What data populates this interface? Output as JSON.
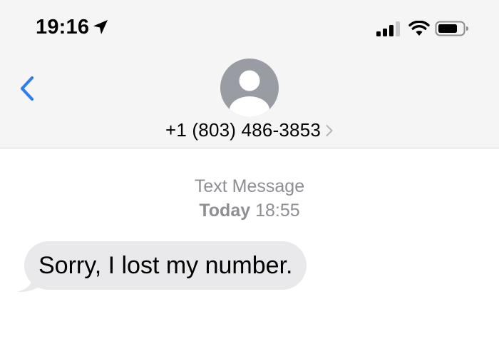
{
  "status_bar": {
    "time": "19:16",
    "icons": [
      "location-arrow-icon",
      "cellular-signal-icon",
      "wifi-icon",
      "battery-icon"
    ]
  },
  "nav": {
    "back_icon": "chevron-left-icon",
    "avatar_icon": "person-silhouette-icon",
    "contact_number": "+1 (803) 486-3853",
    "contact_chevron_icon": "chevron-right-icon"
  },
  "conversation": {
    "service_label": "Text Message",
    "day_label": "Today",
    "time_label": "18:55",
    "messages": [
      {
        "direction": "incoming",
        "text": "Sorry, I lost my number."
      }
    ]
  },
  "colors": {
    "accent_blue": "#2f7cf6",
    "header_bg": "#f5f5f5",
    "incoming_bubble": "#e9e9eb",
    "meta_gray": "#8e8e93",
    "avatar_gray": "#9a9ca3"
  }
}
